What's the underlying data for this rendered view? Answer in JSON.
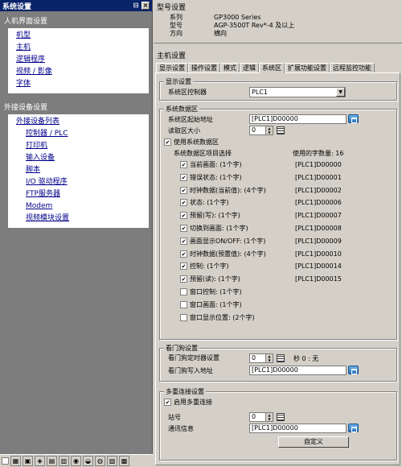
{
  "left_panel": {
    "title": "系统设置",
    "pin_glyph": "⊟",
    "close_glyph": "×",
    "hmi_section": {
      "label": "人机界面设置",
      "items": [
        "机型",
        "主机",
        "逻辑程序",
        "视频 / 影像",
        "字体"
      ]
    },
    "device_section": {
      "label": "外接设备设置",
      "items": [
        {
          "label": "外接设备列表",
          "sub": false
        },
        {
          "label": "控制器 / PLC",
          "sub": true
        },
        {
          "label": "打印机",
          "sub": true
        },
        {
          "label": "输入设备",
          "sub": true
        },
        {
          "label": "脚本",
          "sub": true
        },
        {
          "label": "I/O 驱动程序",
          "sub": true
        },
        {
          "label": "FTP服务器",
          "sub": true
        },
        {
          "label": "Modem",
          "sub": true
        },
        {
          "label": "视频模块设置",
          "sub": true
        }
      ]
    },
    "taskbar_icons": [
      "▦",
      "▣",
      "◈",
      "▤",
      "▥",
      "◉",
      "◒",
      "◍",
      "▧",
      "▩"
    ]
  },
  "model": {
    "heading": "型号设置",
    "rows": [
      {
        "key": "系列",
        "value": "GP3000 Series"
      },
      {
        "key": "型号",
        "value": "AGP-3500T  Rev*-4 及以上"
      },
      {
        "key": "方向",
        "value": "横向"
      }
    ]
  },
  "host": {
    "heading": "主机设置",
    "tabs": [
      "显示设置",
      "操作设置",
      "模式",
      "逻辑",
      "系统区",
      "扩展功能设置",
      "远程监控功能"
    ],
    "active_tab": "系统区"
  },
  "display_group": {
    "title": "显示设置",
    "controller_label": "系统区控制器",
    "controller_value": "PLC1"
  },
  "sysdata_group": {
    "title": "系统数据区",
    "start_label": "系统区起始地址",
    "start_value": "[PLC1]D00000",
    "size_label": "读取区大小",
    "size_value": "0",
    "use_label": "使用系统数据区",
    "items_header": "系统数据区项目选择",
    "words_label": "使用的字数量: 16",
    "items": [
      {
        "label": "当前画面: (1个字)",
        "checked": true,
        "addr": "[PLC1]D00000"
      },
      {
        "label": "错误状态: (1个字)",
        "checked": true,
        "addr": "[PLC1]D00001"
      },
      {
        "label": "时钟数据(当前值): (4个字)",
        "checked": true,
        "addr": "[PLC1]D00002"
      },
      {
        "label": "状态: (1个字)",
        "checked": true,
        "addr": "[PLC1]D00006"
      },
      {
        "label": "预留(写): (1个字)",
        "checked": true,
        "addr": "[PLC1]D00007"
      },
      {
        "label": "切换到画面: (1个字)",
        "checked": true,
        "addr": "[PLC1]D00008"
      },
      {
        "label": "画面显示ON/OFF: (1个字)",
        "checked": true,
        "addr": "[PLC1]D00009"
      },
      {
        "label": "时钟数据(预置值): (4个字)",
        "checked": true,
        "addr": "[PLC1]D00010"
      },
      {
        "label": "控制: (1个字)",
        "checked": true,
        "addr": "[PLC1]D00014"
      },
      {
        "label": "预留(读): (1个字)",
        "checked": true,
        "addr": "[PLC1]D00015"
      },
      {
        "label": "窗口控制: (1个字)",
        "checked": false,
        "addr": ""
      },
      {
        "label": "窗口画面: (1个字)",
        "checked": false,
        "addr": ""
      },
      {
        "label": "窗口显示位置: (2个字)",
        "checked": false,
        "addr": ""
      }
    ]
  },
  "watchdog_group": {
    "title": "看门狗设置",
    "timer_label": "看门狗定时器设置",
    "timer_value": "0",
    "timer_unit": "秒 0 : 无",
    "addr_label": "看门狗写入地址",
    "addr_value": "[PLC1]D00000"
  },
  "multi_group": {
    "title": "多重连接设置",
    "enable_label": "启用多重连接",
    "station_label": "站号",
    "station_value": "0",
    "comm_label": "通讯信息",
    "comm_value": "[PLC1]D00000",
    "custom_button": "自定义"
  }
}
